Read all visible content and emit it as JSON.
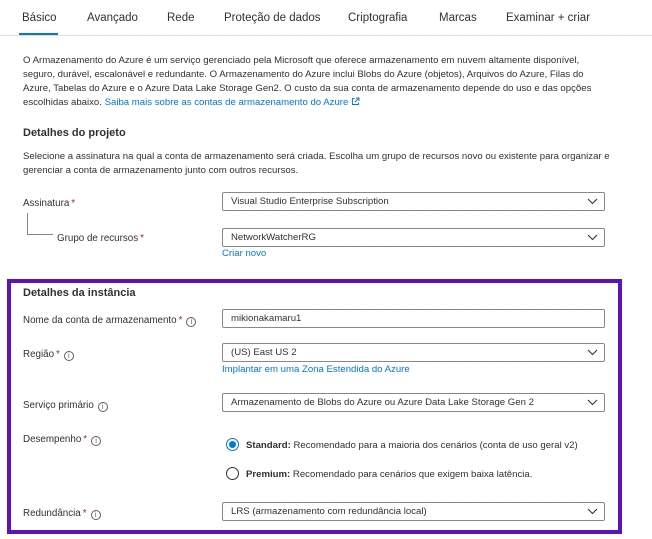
{
  "tabs": [
    {
      "label": "Básico"
    },
    {
      "label": "Avançado"
    },
    {
      "label": "Rede"
    },
    {
      "label": "Proteção de dados"
    },
    {
      "label": "Criptografia"
    },
    {
      "label": "Marcas"
    },
    {
      "label": "Examinar + criar"
    }
  ],
  "intro": {
    "text": "O Armazenamento do Azure é um serviço gerenciado pela Microsoft que oferece armazenamento em nuvem altamente disponível, seguro, durável, escalonável e redundante. O Armazenamento do Azure inclui Blobs do Azure (objetos), Arquivos do Azure, Filas do Azure, Tabelas do Azure e o Azure Data Lake Storage Gen2. O custo da sua conta de armazenamento depende do uso e das opções escolhidas abaixo.",
    "link": "Saiba mais sobre as contas de armazenamento do Azure"
  },
  "project": {
    "title": "Detalhes do projeto",
    "description": "Selecione a assinatura na qual a conta de armazenamento será criada. Escolha um grupo de recursos novo ou existente para organizar e gerenciar a conta de armazenamento junto com outros recursos.",
    "subscription_label": "Assinatura",
    "subscription_value": "Visual Studio Enterprise Subscription",
    "resource_group_label": "Grupo de recursos",
    "resource_group_value": "NetworkWatcherRG",
    "create_new": "Criar novo"
  },
  "instance": {
    "title": "Detalhes da instância",
    "name_label": "Nome da conta de armazenamento",
    "name_value": "mikionakamaru1",
    "region_label": "Região",
    "region_value": "(US) East US 2",
    "region_link": "Implantar em uma Zona Estendida do Azure",
    "service_label": "Serviço primário",
    "service_value": "Armazenamento de Blobs do Azure ou Azure Data Lake Storage Gen 2",
    "performance_label": "Desempenho",
    "standard_name": "Standard:",
    "standard_desc": "Recomendado para a maioria dos cenários (conta de uso geral v2)",
    "premium_name": "Premium:",
    "premium_desc": "Recomendado para cenários que exigem baixa latência.",
    "redundancy_label": "Redundância",
    "redundancy_value": "LRS (armazenamento com redundância local)"
  },
  "required_mark": "*",
  "info_glyph": "i",
  "colors": {
    "accent": "#0078d4",
    "highlight_border": "#5c14b8",
    "required": "#a4262c"
  },
  "icons": [
    "external-link-icon",
    "chevron-down-icon",
    "info-icon"
  ]
}
